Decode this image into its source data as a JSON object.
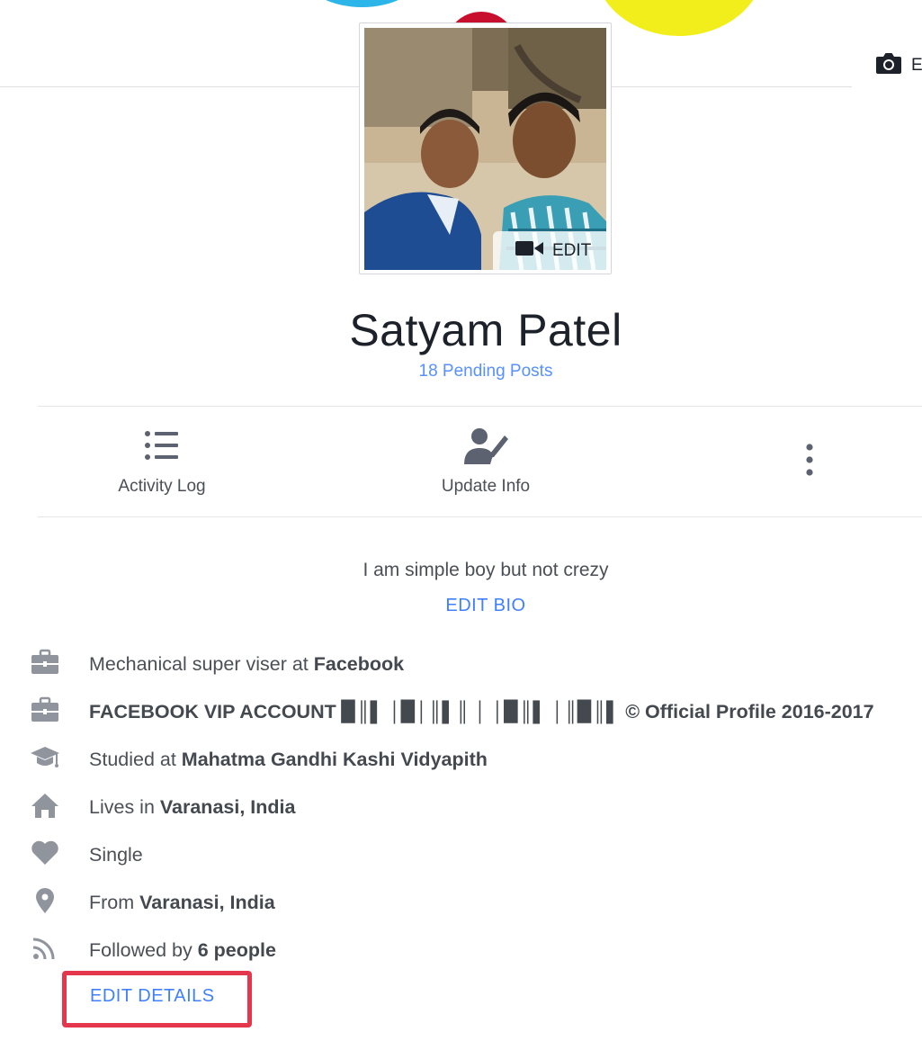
{
  "cover": {
    "edit_label": "E"
  },
  "profile": {
    "photo_edit_label": "EDIT",
    "name": "Satyam Patel",
    "pending_posts": "18 Pending Posts"
  },
  "actions": {
    "activity_log": "Activity Log",
    "update_info": "Update Info"
  },
  "bio": {
    "text": "I am simple boy but not crezy",
    "edit_label": "EDIT BIO"
  },
  "details": {
    "work1": {
      "prefix": "Mechanical super viser at ",
      "bold": "Facebook"
    },
    "work2": {
      "bold": "FACEBOOK VIP ACCOUNT ▉║▌ │▉│║▌║ │ │▉║▌ │║▉║▌ © Official Profile 2016-2017"
    },
    "education": {
      "prefix": "Studied at ",
      "bold": "Mahatma Gandhi Kashi Vidyapith"
    },
    "lives": {
      "prefix": "Lives in ",
      "bold": "Varanasi, India"
    },
    "relationship": {
      "prefix": "Single"
    },
    "from": {
      "prefix": "From ",
      "bold": "Varanasi, India"
    },
    "followers": {
      "prefix": "Followed by ",
      "bold": "6 people"
    },
    "edit_label": "EDIT DETAILS"
  },
  "icons": {
    "cover_camera": "camera-icon",
    "video": "video-camera-icon",
    "activity_log": "list-icon",
    "update_info": "person-edit-icon",
    "more": "more-vertical-icon",
    "work": "briefcase-icon",
    "education": "graduation-cap-icon",
    "home": "home-icon",
    "heart": "heart-icon",
    "location": "location-pin-icon",
    "rss": "rss-feed-icon"
  },
  "colors": {
    "link_blue": "#4080ff",
    "pending_blue": "#5890ff",
    "highlight_red": "#e5374b",
    "icon_gray": "#90949c"
  }
}
